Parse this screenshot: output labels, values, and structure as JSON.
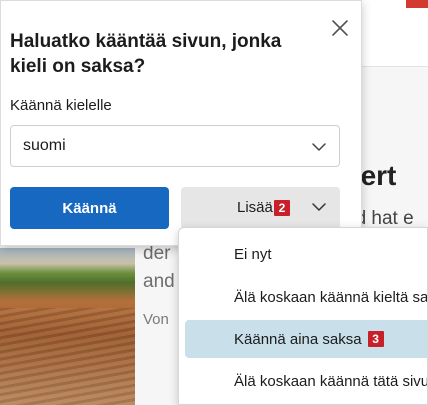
{
  "background": {
    "heading_fragment": "kert",
    "line1_fragment": "nd hat e",
    "line2_fragment": "der",
    "line3_fragment": "and",
    "line4_fragment": "Von"
  },
  "popup": {
    "title": "Haluatko kääntää sivun, jonka kieli on saksa?",
    "language_label": "Käännä kielelle",
    "language_value": "suomi",
    "translate_label": "Käännä",
    "more_label": "Lisää",
    "more_badge": "2",
    "accent_color": "#1668c0"
  },
  "menu": {
    "items": [
      {
        "label": "Ei nyt"
      },
      {
        "label": "Älä koskaan käännä kieltä saksa"
      },
      {
        "label": "Käännä aina saksa",
        "badge": "3",
        "highlighted": true
      },
      {
        "label": "Älä koskaan käännä tätä sivustoa"
      }
    ],
    "highlight_color": "#c9dfea"
  },
  "badge_color": "#c8202a",
  "icons": {
    "close": "close-icon",
    "select_chevron": "chevron-down-icon",
    "more_chevron": "chevron-down-icon"
  }
}
